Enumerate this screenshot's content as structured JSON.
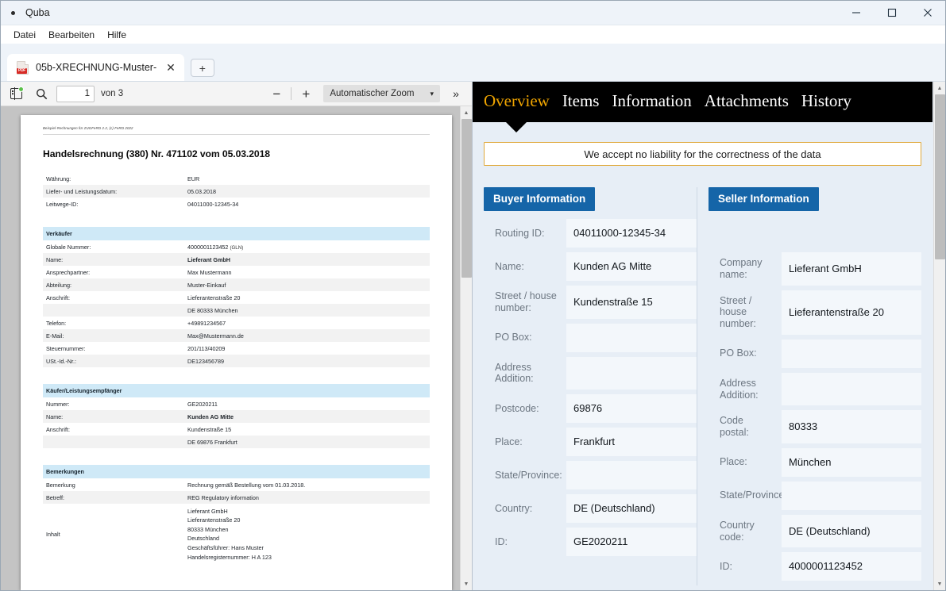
{
  "window": {
    "title": "Quba",
    "minimize_label": "Minimize",
    "maximize_label": "Maximize",
    "close_label": "Close"
  },
  "menu": {
    "items": [
      {
        "label": "Datei"
      },
      {
        "label": "Bearbeiten"
      },
      {
        "label": "Hilfe"
      }
    ]
  },
  "tabstrip": {
    "doc_tab_label": "05b-XRECHNUNG-Muster-",
    "doc_tab_close": "✕",
    "new_tab_label": "+",
    "pdf_badge": "PDF"
  },
  "pdf_toolbar": {
    "sidebar_toggle_title": "Seitenleiste umschalten",
    "search_title": "Suchen",
    "page_number": "1",
    "page_of": "von 3",
    "zoom_out_label": "−",
    "zoom_in_label": "+",
    "zoom_level": "Automatischer Zoom",
    "zoom_chevron": "▾",
    "more_tools_label": "»"
  },
  "pdf_document": {
    "source_note": "Beispiel-Rechnungen für ZUGFeRD 2.2, (c) FeRD 2022",
    "heading": "Handelsrechnung (380)  Nr. 471102  vom  05.03.2018",
    "summary_rows": [
      {
        "key": "Währung:",
        "value": "EUR"
      },
      {
        "key": "Liefer- und Leistungsdatum:",
        "value": "05.03.2018"
      },
      {
        "key": "Leitwege-ID:",
        "value": "04011000-12345-34"
      }
    ],
    "seller_section": {
      "title": "Verkäufer",
      "rows": [
        {
          "key": "Globale Nummer:",
          "value": "4000001123452",
          "suffix": "(GLN)"
        },
        {
          "key": "Name:",
          "value": "Lieferant GmbH",
          "bold": true
        },
        {
          "key": "Ansprechpartner:",
          "value": "Max Mustermann"
        },
        {
          "key": "Abteilung:",
          "value": "Muster-Einkauf"
        },
        {
          "key": "Anschrift:",
          "value": "Lieferantenstraße 20"
        },
        {
          "key": "",
          "value": "DE 80333 München"
        },
        {
          "key": "Telefon:",
          "value": "+49891234567"
        },
        {
          "key": "E-Mail:",
          "value": "Max@Mustermann.de"
        },
        {
          "key": "Steuernummer:",
          "value": "201/113/40209"
        },
        {
          "key": "USt.-Id.-Nr.:",
          "value": "DE123456789"
        }
      ]
    },
    "buyer_section": {
      "title": "Käufer/Leistungsempfänger",
      "rows": [
        {
          "key": "Nummer:",
          "value": "GE2020211"
        },
        {
          "key": "Name:",
          "value": "Kunden AG Mitte",
          "bold": true
        },
        {
          "key": "Anschrift:",
          "value": "Kundenstraße 15"
        },
        {
          "key": "",
          "value": "DE 69876 Frankfurt"
        }
      ]
    },
    "remarks_section": {
      "title": "Bemerkungen",
      "rows": [
        {
          "key": "Bemerkung",
          "value": "Rechnung gemäß Bestellung vom 01.03.2018."
        },
        {
          "key": "Betreff:",
          "value": "REG   Regulatory information"
        },
        {
          "key": "Inhalt",
          "value": "Lieferant GmbH\nLieferantenstraße 20\n80333 München\nDeutschland\nGeschäftsführer: Hans Muster\nHandelsregisternummer: H A 123"
        }
      ]
    }
  },
  "detail": {
    "nav_tabs": [
      {
        "label": "Overview",
        "active": true
      },
      {
        "label": "Items",
        "active": false
      },
      {
        "label": "Information",
        "active": false
      },
      {
        "label": "Attachments",
        "active": false
      },
      {
        "label": "History",
        "active": false
      }
    ],
    "notice": "We accept no liability for the correctness of the data",
    "buyer_card": {
      "title": "Buyer Information",
      "fields": [
        {
          "label": "Routing ID:",
          "value": "04011000-12345-34"
        },
        {
          "label": "Name:",
          "value": "Kunden AG Mitte"
        },
        {
          "label": "Street / house number:",
          "value": "Kundenstraße 15"
        },
        {
          "label": "PO Box:",
          "value": ""
        },
        {
          "label": "Address Addition:",
          "value": ""
        },
        {
          "label": "Postcode:",
          "value": "69876"
        },
        {
          "label": "Place:",
          "value": "Frankfurt"
        },
        {
          "label": "State/Province:",
          "value": ""
        },
        {
          "label": "Country:",
          "value": "DE (Deutschland)"
        },
        {
          "label": "ID:",
          "value": "GE2020211"
        }
      ]
    },
    "seller_card": {
      "title": "Seller Information",
      "fields": [
        {
          "label": "Company name:",
          "value": "Lieferant GmbH"
        },
        {
          "label": "Street / house number:",
          "value": "Lieferantenstraße 20"
        },
        {
          "label": "PO Box:",
          "value": ""
        },
        {
          "label": "Address Addition:",
          "value": ""
        },
        {
          "label": "Code postal:",
          "value": "80333"
        },
        {
          "label": "Place:",
          "value": "München"
        },
        {
          "label": "State/Province:",
          "value": ""
        },
        {
          "label": "Country code:",
          "value": "DE (Deutschland)"
        },
        {
          "label": "ID:",
          "value": "4000001123452"
        }
      ]
    }
  },
  "scrollbars": {
    "up_arrow": "▲",
    "down_arrow": "▼"
  },
  "colors": {
    "accent_orange": "#f0a500",
    "card_header_blue": "#1565a8",
    "nav_background": "#000000",
    "panel_background": "#e7eef6",
    "notice_border": "#e0a93b"
  }
}
